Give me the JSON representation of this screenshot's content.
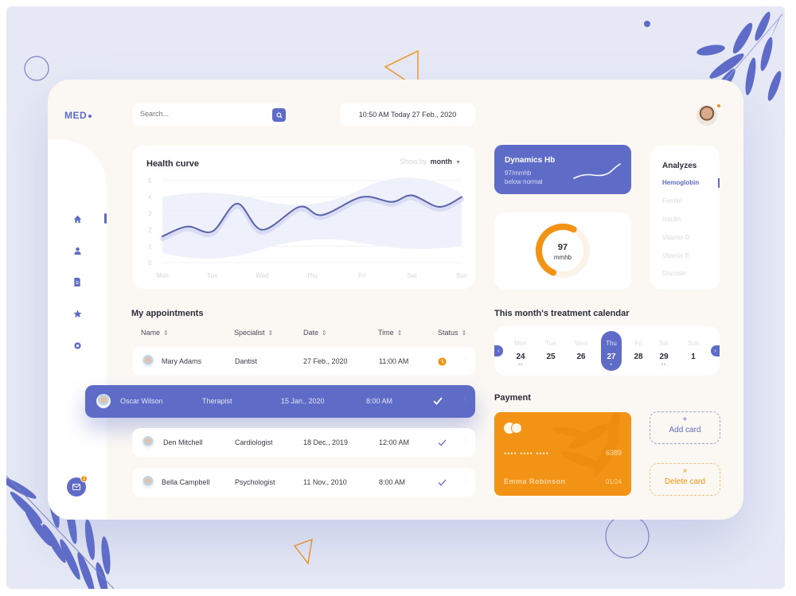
{
  "app": {
    "logo": "MED",
    "search": {
      "placeholder": "Search..."
    },
    "datetime": "10:50 AM Today 27 Feb., 2020",
    "notifications": {
      "mail_count": "2"
    }
  },
  "sidebar": {
    "items": [
      {
        "name": "home",
        "icon": "home-icon",
        "active": true
      },
      {
        "name": "profile",
        "icon": "user-icon",
        "active": false
      },
      {
        "name": "documents",
        "icon": "document-icon",
        "active": false
      },
      {
        "name": "favorites",
        "icon": "star-icon",
        "active": false
      },
      {
        "name": "settings",
        "icon": "gear-icon",
        "active": false
      }
    ]
  },
  "health_curve": {
    "title": "Health curve",
    "show_by_label": "Show by",
    "show_by_value": "month"
  },
  "chart_data": {
    "type": "line",
    "title": "Health curve",
    "categories": [
      "Mon",
      "Tue",
      "Wed",
      "Thu",
      "Fri",
      "Sat",
      "Sun"
    ],
    "x": [
      0,
      0.5,
      1,
      1.5,
      2,
      2.75,
      3.2,
      4,
      4.6,
      5,
      5.55,
      6
    ],
    "series": [
      {
        "name": "Health",
        "values": [
          1.6,
          2.2,
          1.9,
          3.6,
          2.0,
          3.4,
          2.9,
          4.0,
          3.7,
          4.1,
          3.4,
          4.0
        ]
      }
    ],
    "yticks": [
      0,
      1,
      2,
      3,
      4,
      5
    ],
    "ylim": [
      0,
      5
    ],
    "grid": true,
    "xlabel": "",
    "ylabel": ""
  },
  "dynamics": {
    "title": "Dynamics Hb",
    "value_line": "97/mmhb",
    "status": "below normal"
  },
  "gauge": {
    "value": "97",
    "unit": "mmhb",
    "fill_fraction": 0.6
  },
  "analyzes": {
    "title": "Analyzes",
    "items": [
      "Hemoglobin",
      "Ferritin",
      "Insulin",
      "Vitamin D",
      "Vitamin E",
      "Glucose"
    ],
    "active": "Hemoglobin"
  },
  "appointments": {
    "title": "My appointments",
    "columns": [
      "Name",
      "Specialist",
      "Date",
      "Time",
      "Status"
    ],
    "rows": [
      {
        "name": "Mary Adams",
        "specialist": "Dantist",
        "date": "27 Feb., 2020",
        "time": "11:00 AM",
        "status": "pending"
      },
      {
        "name": "Oscar Wilson",
        "specialist": "Therapist",
        "date": "15 Jan., 2020",
        "time": "8:00 AM",
        "status": "done"
      },
      {
        "name": "Den Mitchell",
        "specialist": "Cardiologist",
        "date": "18 Dec., 2019",
        "time": "12:00 AM",
        "status": "done"
      },
      {
        "name": "Bella Campbell",
        "specialist": "Psychologist",
        "date": "11 Nov., 2010",
        "time": "8:00 AM",
        "status": "done"
      }
    ]
  },
  "calendar": {
    "title": "This month's treatment calendar",
    "days": [
      {
        "name": "Mon",
        "date": "24",
        "dots": "••"
      },
      {
        "name": "Tue",
        "date": "25",
        "dots": ""
      },
      {
        "name": "Wed",
        "date": "26",
        "dots": ""
      },
      {
        "name": "Thu",
        "date": "27",
        "dots": "•"
      },
      {
        "name": "Fri",
        "date": "28",
        "dots": ""
      },
      {
        "name": "Sat",
        "date": "29",
        "dots": "••"
      },
      {
        "name": "Sun",
        "date": "1",
        "dots": ""
      }
    ],
    "active_date": "27"
  },
  "payment": {
    "title": "Payment",
    "card": {
      "masked": "•••• •••• ••••",
      "last4": "6389",
      "holder": "Emma Robinson",
      "expiry": "01/24"
    },
    "add_label": "Add card",
    "add_symbol": "+",
    "delete_label": "Delete card",
    "delete_symbol": "×"
  },
  "colors": {
    "primary": "#5e6cc8",
    "accent": "#f29315",
    "background": "#fbf8f4"
  }
}
